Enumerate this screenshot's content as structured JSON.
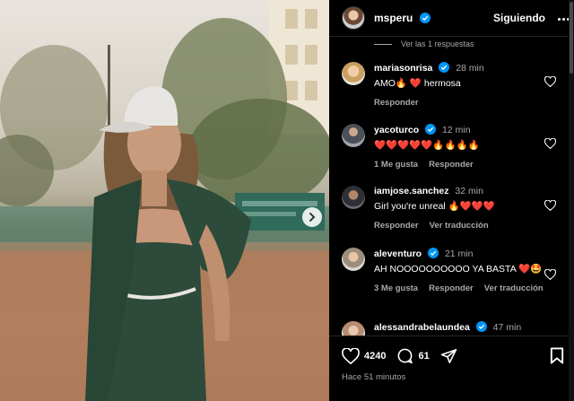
{
  "post": {
    "author": "msperu",
    "follow_label": "Siguiendo",
    "time_ago": "Hace 51 minutos",
    "likes": "4240",
    "comments_count": "61"
  },
  "comments": {
    "view_replies": "Ver las 1 respuestas",
    "items": [
      {
        "user": "mariasonrisa",
        "verified": true,
        "time": "28 min",
        "text": "AMO🔥 ❤️  hermosa",
        "likes_label": "",
        "reply_label": "Responder",
        "translate_label": ""
      },
      {
        "user": "yacoturco",
        "verified": true,
        "time": "12 min",
        "text": "❤️❤️❤️❤️❤️🔥🔥🔥🔥",
        "likes_label": "1 Me gusta",
        "reply_label": "Responder",
        "translate_label": ""
      },
      {
        "user": "iamjose.sanchez",
        "verified": false,
        "time": "32 min",
        "text": "Girl you're unreal 🔥❤️❤️❤️",
        "likes_label": "",
        "reply_label": "Responder",
        "translate_label": "Ver traducción"
      },
      {
        "user": "aleventuro",
        "verified": true,
        "time": "21 min",
        "text": "AH NOOOOOOOOOO YA BASTA ❤️🤩",
        "likes_label": "3 Me gusta",
        "reply_label": "Responder",
        "translate_label": "Ver traducción"
      },
      {
        "user": "alessandrabelaundea",
        "verified": true,
        "time": "47 min",
        "text": "",
        "likes_label": "",
        "reply_label": "",
        "translate_label": ""
      }
    ]
  },
  "colors": {
    "verified": "#0095f6",
    "secondary_text": "#a8a8a8",
    "divider": "#262626"
  },
  "icons": [
    "verified-badge-icon",
    "more-options-icon",
    "heart-icon",
    "comment-icon",
    "share-icon",
    "bookmark-icon",
    "chevron-right-icon"
  ]
}
